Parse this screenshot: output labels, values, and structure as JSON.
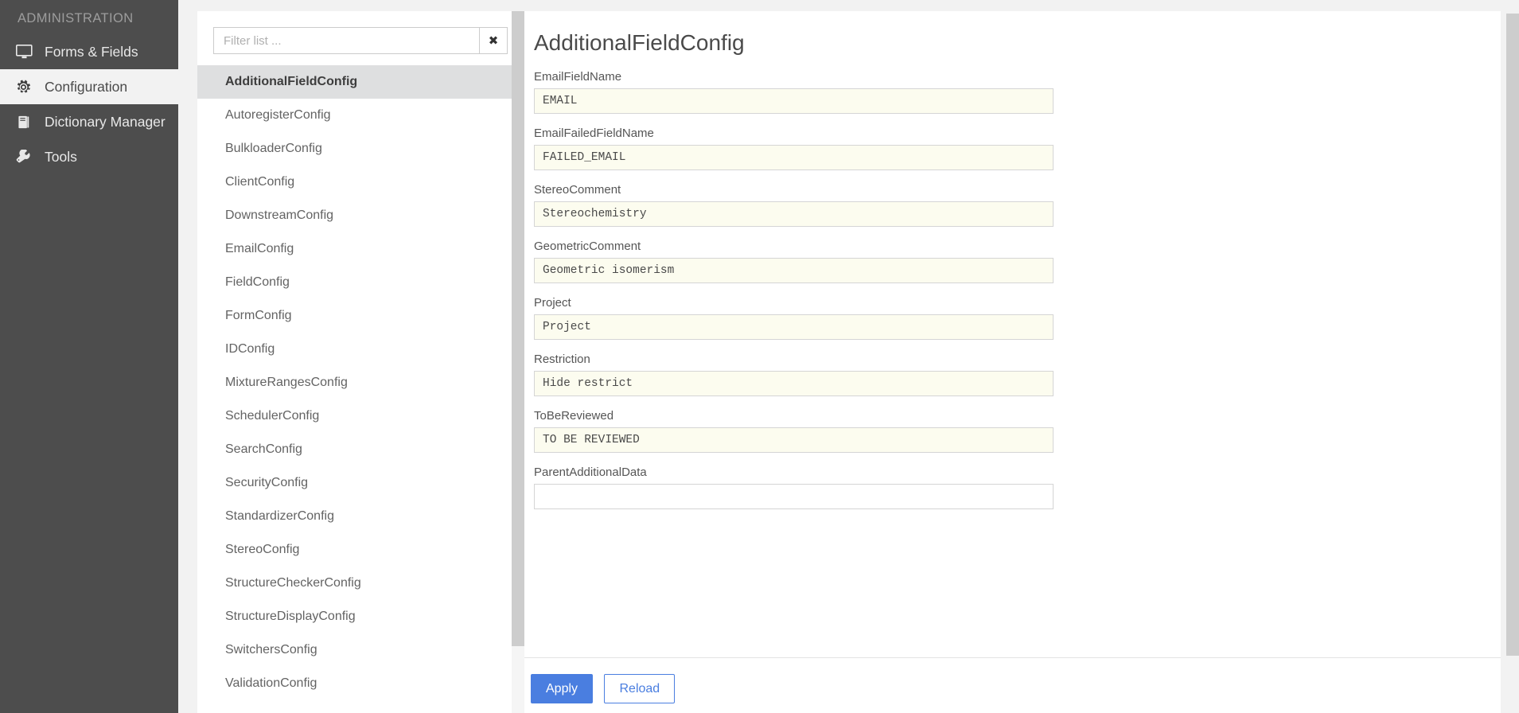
{
  "sidebar": {
    "heading": "ADMINISTRATION",
    "items": [
      {
        "label": "Forms & Fields",
        "icon": "monitor-icon",
        "active": false
      },
      {
        "label": "Configuration",
        "icon": "gear-icon",
        "active": true
      },
      {
        "label": "Dictionary Manager",
        "icon": "book-icon",
        "active": false
      },
      {
        "label": "Tools",
        "icon": "wrench-icon",
        "active": false
      }
    ]
  },
  "list_panel": {
    "filter": {
      "value": "",
      "placeholder": "Filter list ..."
    },
    "clear_label": "✖",
    "items": [
      "AdditionalFieldConfig",
      "AutoregisterConfig",
      "BulkloaderConfig",
      "ClientConfig",
      "DownstreamConfig",
      "EmailConfig",
      "FieldConfig",
      "FormConfig",
      "IDConfig",
      "MixtureRangesConfig",
      "SchedulerConfig",
      "SearchConfig",
      "SecurityConfig",
      "StandardizerConfig",
      "StereoConfig",
      "StructureCheckerConfig",
      "StructureDisplayConfig",
      "SwitchersConfig",
      "ValidationConfig"
    ],
    "selected_index": 0
  },
  "main": {
    "title": "AdditionalFieldConfig",
    "fields": [
      {
        "label": "EmailFieldName",
        "value": "EMAIL"
      },
      {
        "label": "EmailFailedFieldName",
        "value": "FAILED_EMAIL"
      },
      {
        "label": "StereoComment",
        "value": "Stereochemistry"
      },
      {
        "label": "GeometricComment",
        "value": "Geometric isomerism"
      },
      {
        "label": "Project",
        "value": "Project"
      },
      {
        "label": "Restriction",
        "value": "Hide restrict"
      },
      {
        "label": "ToBeReviewed",
        "value": "TO BE REVIEWED"
      },
      {
        "label": "ParentAdditionalData",
        "value": ""
      }
    ],
    "apply_label": "Apply",
    "reload_label": "Reload"
  },
  "colors": {
    "sidebar_bg": "#4d4d4d",
    "accent_blue": "#4a7ee0",
    "input_bg": "#fcfcef",
    "selected_row_bg": "#dedfe0",
    "page_bg": "#f2f2f2"
  }
}
